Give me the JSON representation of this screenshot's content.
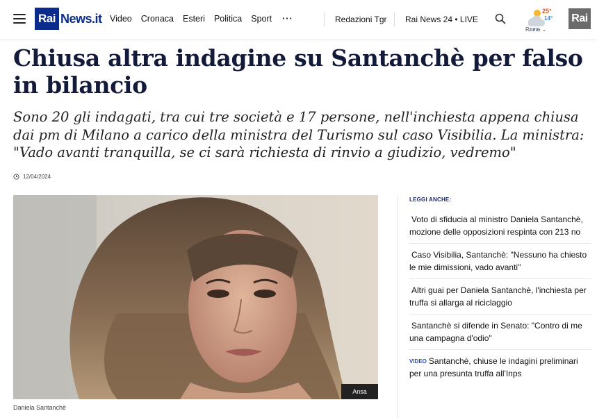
{
  "header": {
    "logo_box": "Rai",
    "logo_text": "News.it",
    "nav": [
      "Video",
      "Cronaca",
      "Esteri",
      "Politica",
      "Sport"
    ],
    "more": "···",
    "redazioni": "Redazioni Tgr",
    "live": "Rai News 24 • LIVE",
    "weather": {
      "hi": "25°",
      "lo": "14°",
      "city": "Roma ⌄"
    },
    "rai_badge": "Rai"
  },
  "article": {
    "title": "Chiusa altra indagine su Santanchè per falso in bilancio",
    "subtitle": "Sono 20 gli indagati, tra cui tre società e 17 persone, nell'inchiesta appena chiusa dai pm di Milano a carico della ministra del Turismo sul caso Visibilia. La ministra: \"Vado avanti tranquilla, se ci sarà richiesta di rinvio a giudizio, vedremo\"",
    "date": "12/04/2024",
    "photo_credit": "Ansa",
    "caption": "Daniela Santanchè"
  },
  "sidebar": {
    "heading": "LEGGI ANCHE:",
    "items": [
      {
        "tag": "",
        "text": "Voto di sfiducia al ministro Daniela Santanchè, mozione delle opposizioni respinta con 213 no"
      },
      {
        "tag": "",
        "text": "Caso Visibilia, Santanchè: \"Nessuno ha chiesto le mie dimissioni, vado avanti\""
      },
      {
        "tag": "",
        "text": "Altri guai per Daniela Santanchè, l'inchiesta per truffa si allarga al riciclaggio"
      },
      {
        "tag": "",
        "text": "Santanchè si difende in Senato: \"Contro di me una campagna d'odio\""
      },
      {
        "tag": "VIDEO",
        "text": "Santanchè, chiuse le indagini preliminari per una presunta truffa all'Inps"
      }
    ]
  },
  "colors": {
    "brand": "#0b2c8a",
    "title": "#131a3a",
    "video_tag": "#2c4fb5"
  }
}
